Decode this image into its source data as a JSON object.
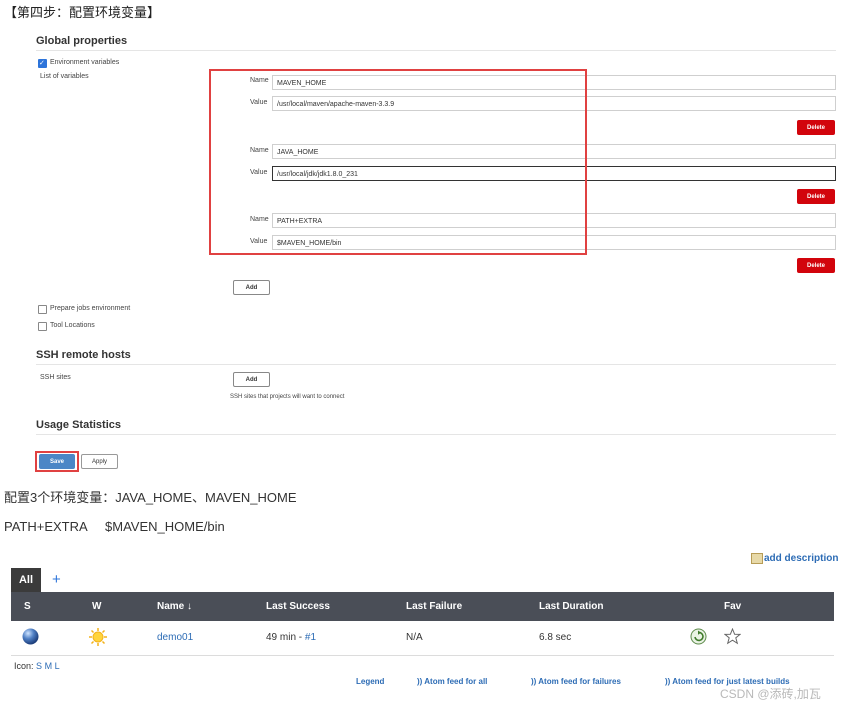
{
  "step_title": "【第四步：配置环境变量】",
  "global_properties": {
    "title": "Global properties",
    "env_vars_label": "Environment variables",
    "list_label": "List of variables",
    "variables": [
      {
        "name_label": "Name",
        "name": "MAVEN_HOME",
        "value_label": "Value",
        "value": "/usr/local/maven/apache-maven-3.3.9",
        "delete": "Delete"
      },
      {
        "name_label": "Name",
        "name": "JAVA_HOME",
        "value_label": "Value",
        "value": "/usr/local/jdk/jdk1.8.0_231",
        "delete": "Delete"
      },
      {
        "name_label": "Name",
        "name": "PATH+EXTRA",
        "value_label": "Value",
        "value": "$MAVEN_HOME/bin",
        "delete": "Delete"
      }
    ],
    "add": "Add",
    "prepare_jobs": "Prepare jobs environment",
    "tool_locations": "Tool Locations"
  },
  "ssh": {
    "title": "SSH remote hosts",
    "sites_label": "SSH sites",
    "add": "Add",
    "help": "SSH sites that projects will want to connect"
  },
  "usage": {
    "title": "Usage Statistics"
  },
  "buttons": {
    "save": "Save",
    "apply": "Apply"
  },
  "notes": {
    "line1": "配置3个环境变量：JAVA_HOME、MAVEN_HOME",
    "line2": "PATH+EXTRA     $MAVEN_HOME/bin"
  },
  "dashboard": {
    "add_description": "add description",
    "tabs": {
      "all": "All",
      "plus": "+"
    },
    "columns": {
      "s": "S",
      "w": "W",
      "name": "Name ↓",
      "last_success": "Last Success",
      "last_failure": "Last Failure",
      "last_duration": "Last Duration",
      "fav": "Fav"
    },
    "row": {
      "name": "demo01",
      "last_success": "49 min - ",
      "build": "#1",
      "last_failure": "N/A",
      "last_duration": "6.8 sec"
    },
    "icon_label": "Icon:",
    "icon_sizes": [
      "S",
      "M",
      "L"
    ],
    "footer": {
      "legend": "Legend",
      "atom_all": "Atom feed for all",
      "atom_failures": "Atom feed for failures",
      "atom_latest": "Atom feed for just latest builds"
    }
  },
  "watermark": "CSDN @添砖,加瓦",
  "colors": {
    "delete": "#d2040c",
    "accent": "#2d74da",
    "highlight": "#e04141",
    "table_header": "#4a4e57"
  }
}
